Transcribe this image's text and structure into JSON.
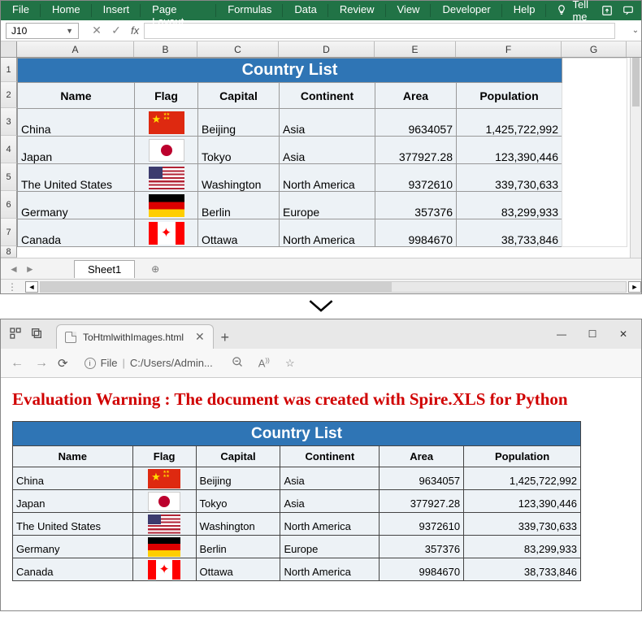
{
  "excel": {
    "ribbon_tabs": [
      "File",
      "Home",
      "Insert",
      "Page Layout",
      "Formulas",
      "Data",
      "Review",
      "View",
      "Developer",
      "Help"
    ],
    "tell_me": "Tell me",
    "namebox": "J10",
    "columns": [
      "A",
      "B",
      "C",
      "D",
      "E",
      "F",
      "G"
    ],
    "row_numbers": [
      "1",
      "2",
      "3",
      "4",
      "5",
      "6",
      "7",
      "8"
    ],
    "sheet_tab": "Sheet1"
  },
  "table": {
    "title": "Country List",
    "headers": [
      "Name",
      "Flag",
      "Capital",
      "Continent",
      "Area",
      "Population"
    ],
    "rows": [
      {
        "name": "China",
        "flag": "cn",
        "capital": "Beijing",
        "continent": "Asia",
        "area": "9634057",
        "population": "1,425,722,992"
      },
      {
        "name": "Japan",
        "flag": "jp",
        "capital": "Tokyo",
        "continent": "Asia",
        "area": "377927.28",
        "population": "123,390,446"
      },
      {
        "name": "The United States",
        "flag": "us",
        "capital": "Washington",
        "continent": "North America",
        "area": "9372610",
        "population": "339,730,633"
      },
      {
        "name": "Germany",
        "flag": "de",
        "capital": "Berlin",
        "continent": "Europe",
        "area": "357376",
        "population": "83,299,933"
      },
      {
        "name": "Canada",
        "flag": "ca",
        "capital": "Ottawa",
        "continent": "North America",
        "area": "9984670",
        "population": "38,733,846"
      }
    ]
  },
  "browser": {
    "tab_title": "ToHtmlwithImages.html",
    "url_scheme": "File",
    "url_path": "C:/Users/Admin...",
    "warning": "Evaluation Warning : The document was created with  Spire.XLS for Python"
  },
  "chart_data": {
    "type": "table",
    "title": "Country List",
    "columns": [
      "Name",
      "Flag",
      "Capital",
      "Continent",
      "Area",
      "Population"
    ],
    "rows": [
      [
        "China",
        "cn",
        "Beijing",
        "Asia",
        9634057,
        1425722992
      ],
      [
        "Japan",
        "jp",
        "Tokyo",
        "Asia",
        377927.28,
        123390446
      ],
      [
        "The United States",
        "us",
        "Washington",
        "North America",
        9372610,
        339730633
      ],
      [
        "Germany",
        "de",
        "Berlin",
        "Europe",
        357376,
        83299933
      ],
      [
        "Canada",
        "ca",
        "Ottawa",
        "North America",
        9984670,
        38733846
      ]
    ]
  }
}
